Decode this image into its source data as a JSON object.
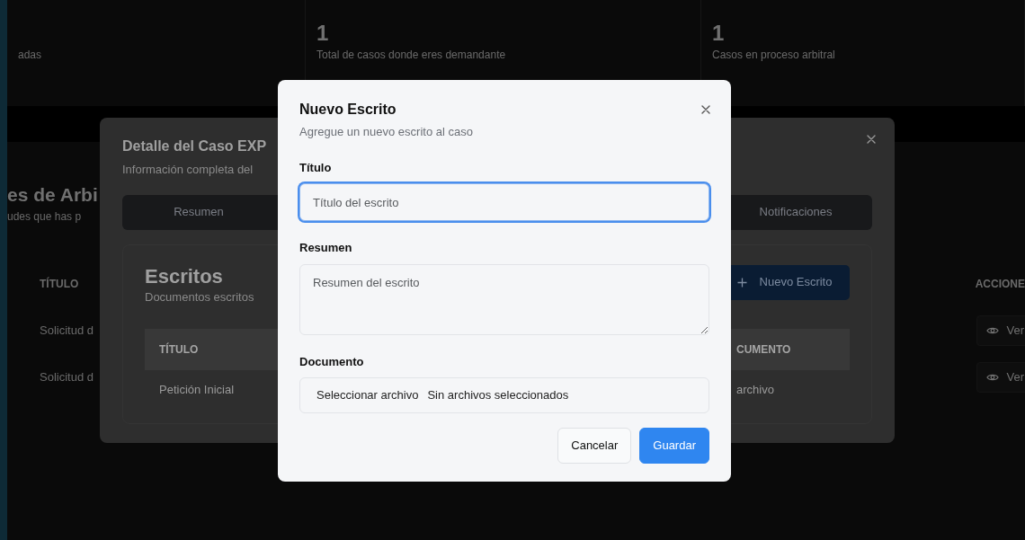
{
  "background_page": {
    "stats": [
      {
        "caption": "adas"
      },
      {
        "value": "1",
        "caption": "Total de casos donde eres demandante"
      },
      {
        "value": "1",
        "caption": "Casos en proceso arbitral"
      }
    ],
    "heading": "es de Arbi",
    "subheading": "udes que has p",
    "table": {
      "columns": [
        "TÍTULO",
        "ACCIONE"
      ],
      "rows": [
        {
          "title": "Solicitud d",
          "action": "Ver"
        },
        {
          "title": "Solicitud d",
          "action": "Ver"
        }
      ]
    }
  },
  "case_dialog": {
    "title": "Detalle del Caso EXP",
    "subtitle": "Información completa del",
    "tabs": [
      {
        "label": "Resumen",
        "selected": false
      },
      {
        "label": "Notificaciones",
        "selected": false
      }
    ],
    "card": {
      "title": "Escritos",
      "subtitle": "Documentos escritos",
      "button": "Nuevo Escrito",
      "columns": [
        "TÍTULO",
        "CUMENTO"
      ],
      "rows": [
        [
          "Petición Inicial",
          "archivo"
        ]
      ]
    }
  },
  "dialog": {
    "title": "Nuevo Escrito",
    "subtitle": "Agregue un nuevo escrito al caso",
    "fields": [
      {
        "kind": "text",
        "label": "Título",
        "placeholder": "Título del escrito",
        "focused": true
      },
      {
        "kind": "textarea",
        "label": "Resumen",
        "placeholder": "Resumen del escrito"
      },
      {
        "kind": "file",
        "label": "Documento",
        "button": "Seleccionar archivo",
        "status": "Sin archivos seleccionados"
      }
    ],
    "buttons": [
      {
        "label": "Cancelar",
        "kind": "secondary"
      },
      {
        "label": "Guardar",
        "kind": "primary"
      }
    ]
  }
}
